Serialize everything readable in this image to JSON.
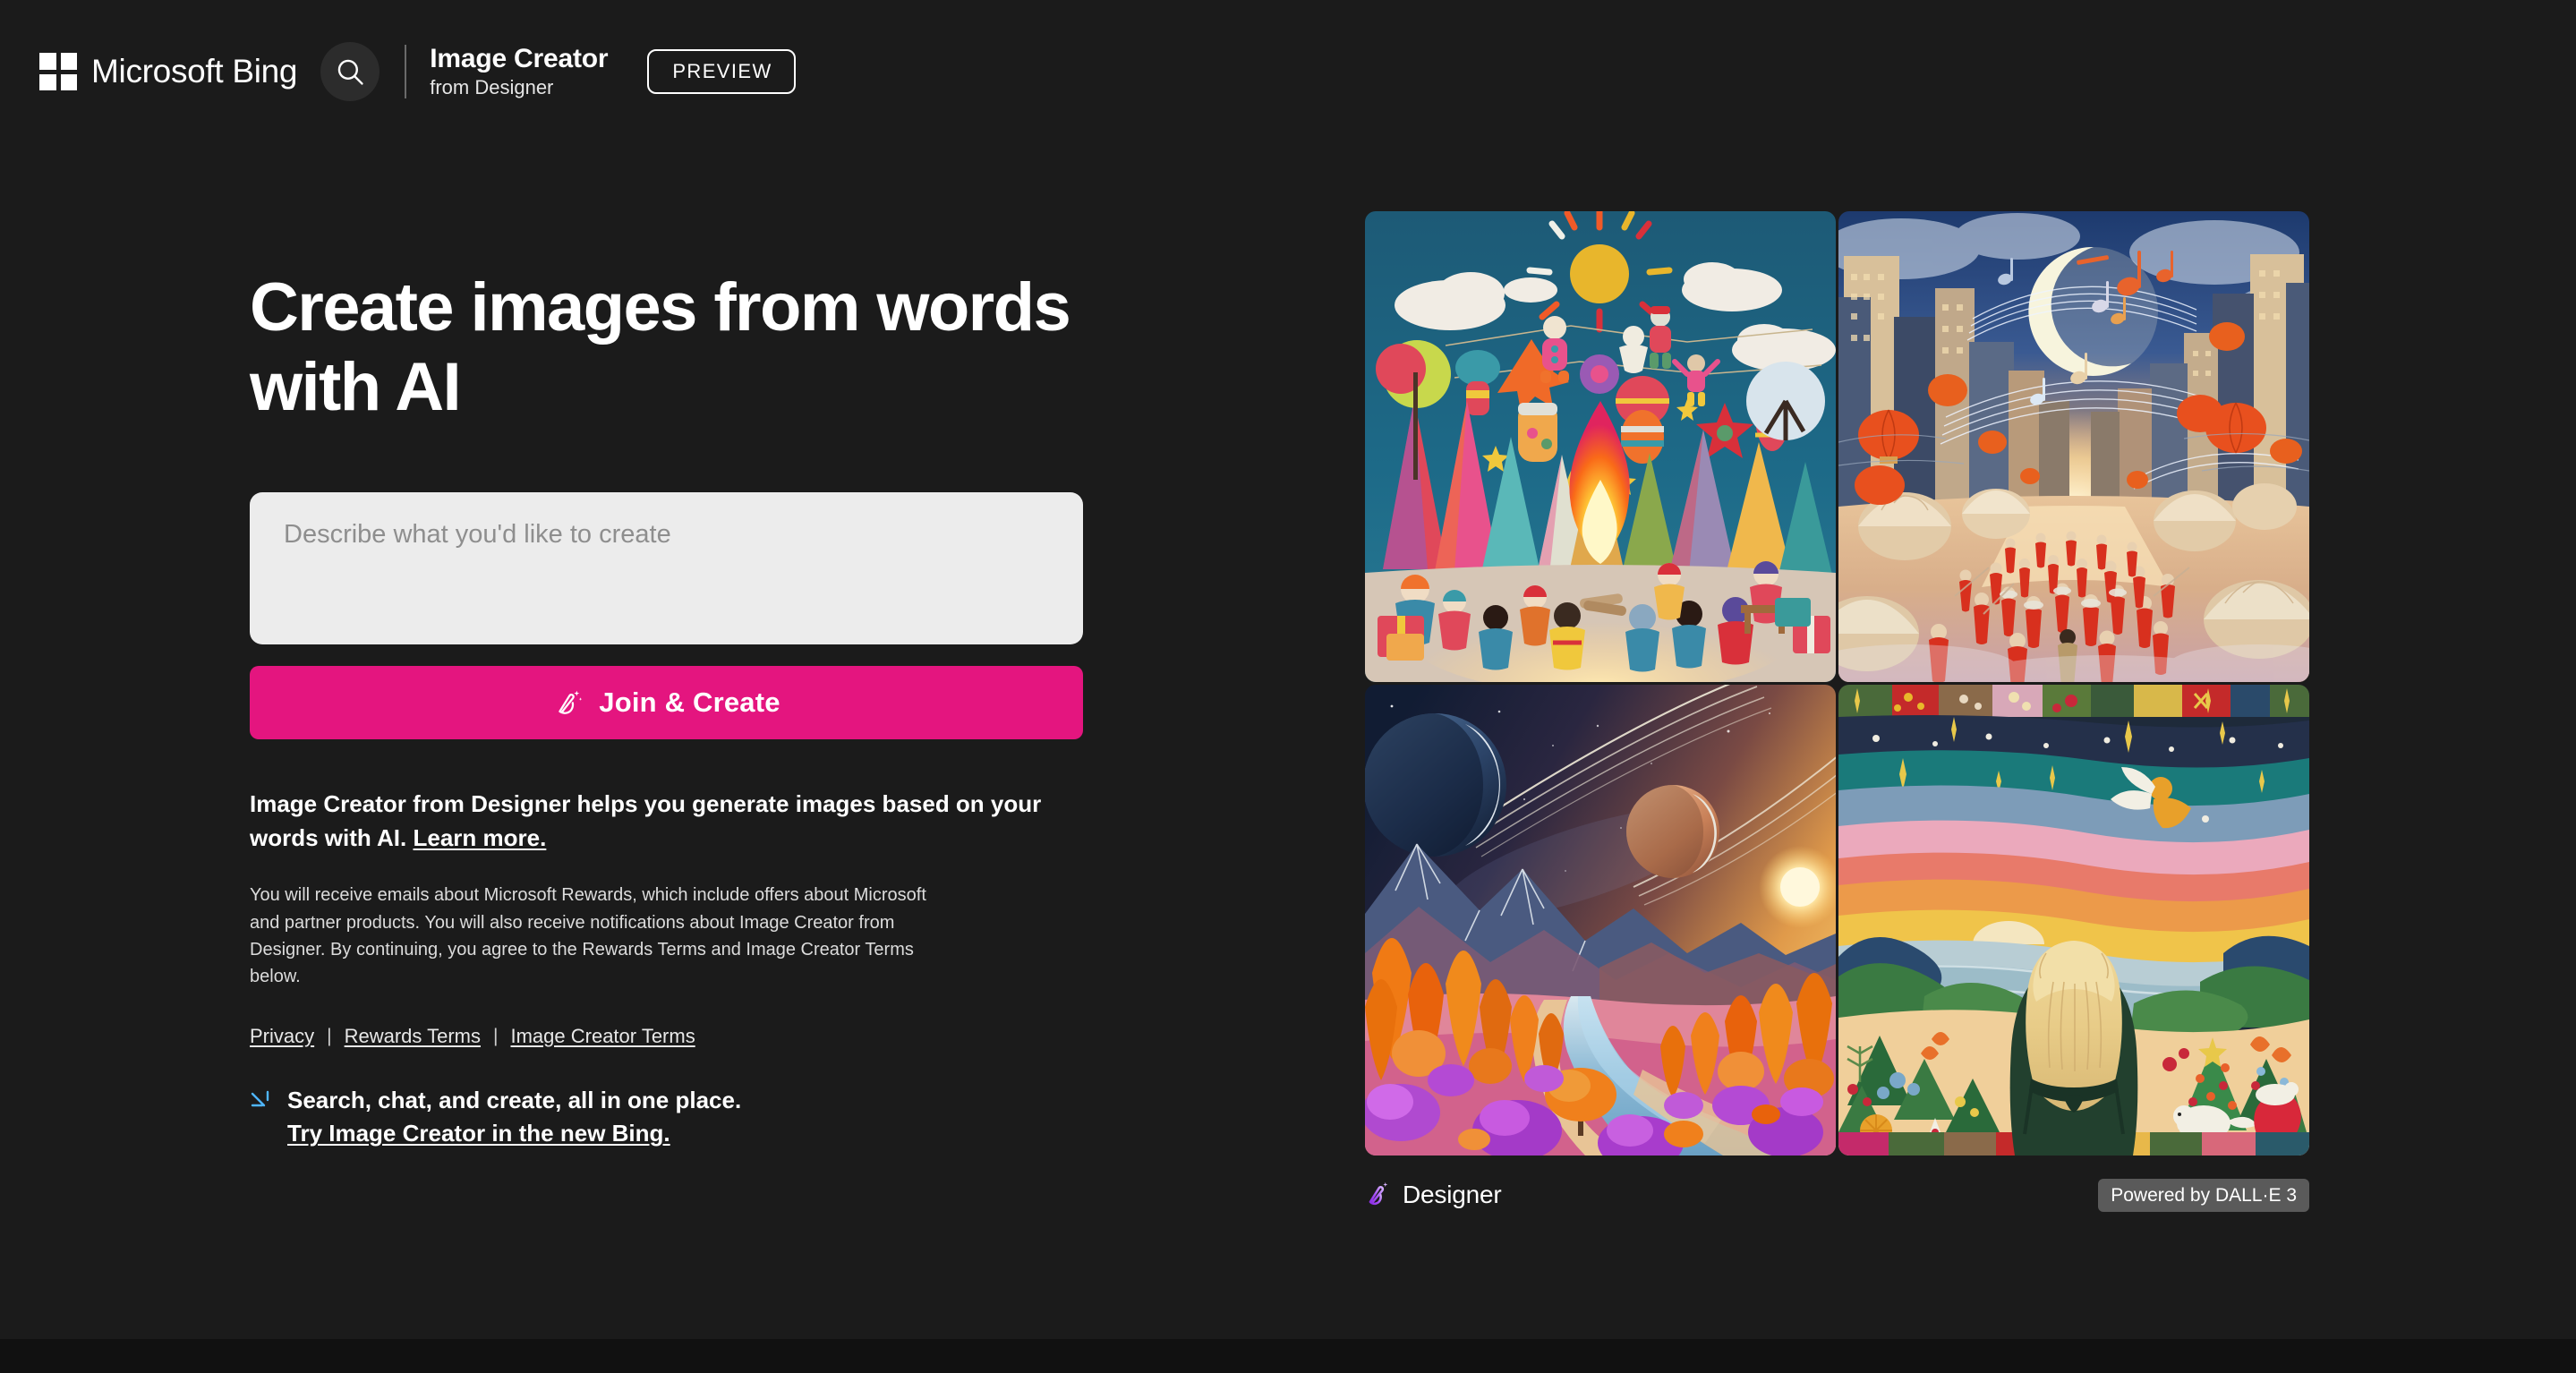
{
  "header": {
    "brand": "Microsoft Bing",
    "ms_logo_icon": "microsoft-squares-icon",
    "search_icon": "search-icon",
    "product_title": "Image Creator",
    "product_subtitle": "from Designer",
    "preview_badge": "PREVIEW"
  },
  "hero": {
    "title": "Create images from words with AI",
    "prompt_placeholder": "Describe what you'd like to create",
    "prompt_value": "",
    "cta_label": "Join & Create",
    "cta_icon": "magic-brush-icon",
    "cta_color": "#e4157f"
  },
  "blurb": {
    "text": "Image Creator from Designer helps you generate images based on your words with AI.",
    "learn_more": "Learn more."
  },
  "legal": {
    "text": "You will receive emails about Microsoft Rewards, which include offers about Microsoft and partner products. You will also receive notifications about Image Creator from Designer. By continuing, you agree to the Rewards Terms and Image Creator Terms below."
  },
  "links": {
    "separator": "|",
    "items": [
      {
        "label": "Privacy"
      },
      {
        "label": "Rewards Terms"
      },
      {
        "label": "Image Creator Terms"
      }
    ]
  },
  "chat_promo": {
    "icon": "bing-chat-sparkle-icon",
    "line1": "Search, chat, and create, all in one place.",
    "line2": "Try Image Creator in the new Bing."
  },
  "gallery": {
    "tiles": [
      {
        "name": "felt-bonfire-forest-scene",
        "alt": "Needle-felted woolly forest with children around a bonfire under a felt sun and clouds"
      },
      {
        "name": "moonlit-city-lantern-parade",
        "alt": "Crescent moon over a golden city with red-robed crowd, lanterns and floating music notes"
      },
      {
        "name": "alien-valley-twin-moons",
        "alt": "Orange forest valley with a river under two ringed moons and a rising sun"
      },
      {
        "name": "felt-woman-sunset-landscape",
        "alt": "Felted tapestry of a blonde woman viewing a pastel sunset over hills with an angel"
      }
    ],
    "footer": {
      "designer_icon": "designer-wand-icon",
      "designer_label": "Designer",
      "powered_badge": "Powered by DALL·E 3"
    }
  },
  "theme": {
    "background": "#1b1b1b",
    "bottom_strip": "#111111",
    "accent_pink": "#e4157f",
    "input_background": "#ececec",
    "badge_gray": "#5a5a5a"
  }
}
